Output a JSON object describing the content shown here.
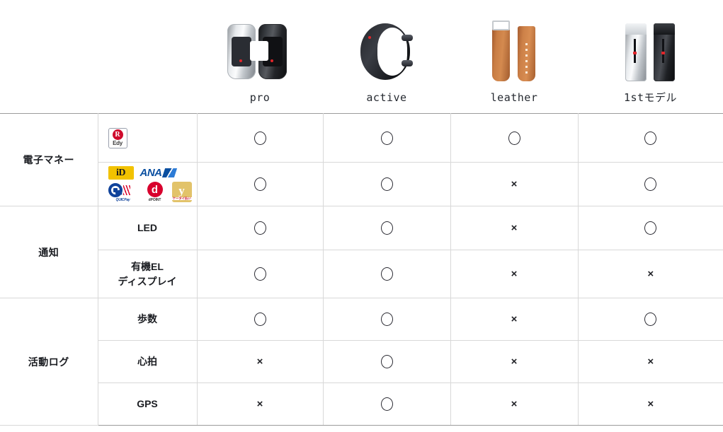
{
  "models": [
    {
      "id": "pro",
      "label": "pro",
      "image": "wristband-pro-silver-black-photo"
    },
    {
      "id": "active",
      "label": "active",
      "image": "wristband-active-black-photo"
    },
    {
      "id": "leather",
      "label": "leather",
      "image": "wristband-leather-brown-photo"
    },
    {
      "id": "1st",
      "label": "1stモデル",
      "image": "wristband-1st-model-silver-black-photo"
    }
  ],
  "groups": [
    {
      "label": "電子マネー",
      "rows": [
        {
          "item_type": "logos",
          "logos": [
            {
              "name": "edy-logo",
              "letter": "R",
              "text": "Edy"
            }
          ],
          "values": [
            "○",
            "○",
            "○",
            "○"
          ]
        },
        {
          "item_type": "logos",
          "logos": [
            {
              "name": "id-logo",
              "text": "iD"
            },
            {
              "name": "ana-logo",
              "text": "ANA"
            },
            {
              "name": "quicpay-logo",
              "text": "QUICPay"
            },
            {
              "name": "dpoint-logo",
              "letter": "d",
              "text": "dPOINT"
            },
            {
              "name": "yahoo-wallet-logo",
              "letter": "y",
              "text": "ケータイ払い"
            }
          ],
          "values": [
            "○",
            "○",
            "×",
            "○"
          ]
        }
      ]
    },
    {
      "label": "通知",
      "rows": [
        {
          "item_type": "text",
          "label": "LED",
          "values": [
            "○",
            "○",
            "×",
            "○"
          ]
        },
        {
          "item_type": "text",
          "label": "有機EL\nディスプレイ",
          "label_line1": "有機EL",
          "label_line2": "ディスプレイ",
          "values": [
            "○",
            "○",
            "×",
            "×"
          ]
        }
      ]
    },
    {
      "label": "活動ログ",
      "rows": [
        {
          "item_type": "text",
          "label": "歩数",
          "values": [
            "○",
            "○",
            "×",
            "○"
          ]
        },
        {
          "item_type": "text",
          "label": "心拍",
          "values": [
            "×",
            "○",
            "×",
            "×"
          ]
        },
        {
          "item_type": "text",
          "label": "GPS",
          "values": [
            "×",
            "○",
            "×",
            "×"
          ]
        }
      ]
    }
  ],
  "marks": {
    "yes": "○",
    "no": "×"
  },
  "colors": {
    "border_light": "#d8d8d8",
    "border_strong": "#9b9b9b",
    "text": "#1b1d22",
    "edy_red": "#cf0a2c",
    "id_yellow": "#f2c200",
    "ana_blue": "#0a4fa0",
    "quicpay_blue": "#10439b",
    "dpoint_red": "#d8002d",
    "ywallet_gold": "#e2c36a"
  }
}
